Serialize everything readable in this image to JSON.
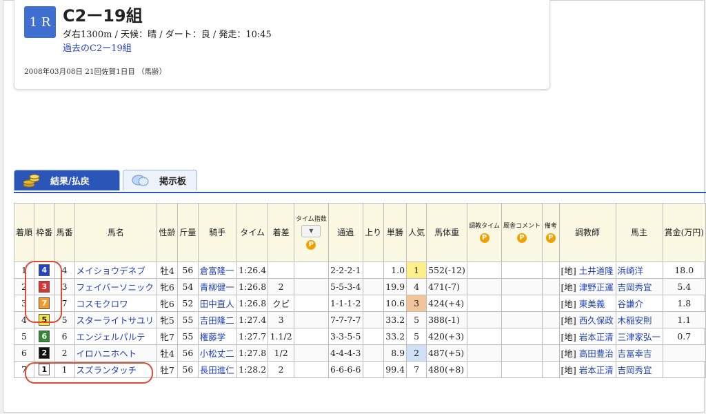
{
  "race": {
    "badge": "1 R",
    "title": "C2ー19組",
    "meta": "ダ右1300m / 天候：晴 / ダート：良 / 発走：10:45",
    "past_link": "過去のC2ー19組",
    "date_line": "2008年03月08日 21回佐賀1日目 （馬齢）"
  },
  "tabs": [
    {
      "label": "結果/払戻"
    },
    {
      "label": "掲示板"
    }
  ],
  "table": {
    "headers": {
      "rank": "着順",
      "frame": "枠番",
      "num": "馬番",
      "horse": "馬名",
      "sexage": "性齢",
      "weight": "斤量",
      "jockey": "騎手",
      "time": "タイム",
      "margin": "着差",
      "timeindex": "タイム指数",
      "passing": "通過",
      "last": "上り",
      "odds": "単勝",
      "pop": "人気",
      "bodyweight": "馬体重",
      "train_time": "調教タイム",
      "stable_comment": "厩舎コメント",
      "notes": "備考",
      "trainer": "調教師",
      "owner": "馬主",
      "prize": "賞金(万円)",
      "p": "P"
    },
    "rows": [
      {
        "rank": "1",
        "frame": "4",
        "num": "4",
        "horse": "メイショウデネブ",
        "sexage": "牡4",
        "weight": "56",
        "jockey": "倉富隆一",
        "time": "1:26.4",
        "margin": "",
        "passing": "2-2-2-1",
        "last": "",
        "odds": "1.0",
        "pop": "1",
        "bodyweight": "552(-12)",
        "trainer": "[地] 土井道隆",
        "owner": "浜崎洋",
        "prize": "18.0"
      },
      {
        "rank": "2",
        "frame": "3",
        "num": "3",
        "horse": "フェイバーソニック",
        "sexage": "牝6",
        "weight": "54",
        "jockey": "青柳健一",
        "time": "1:26.8",
        "margin": "2",
        "passing": "5-5-3-4",
        "last": "",
        "odds": "19.9",
        "pop": "4",
        "bodyweight": "471(-7)",
        "trainer": "[地] 津野正運",
        "owner": "吉岡秀宜",
        "prize": "5.4"
      },
      {
        "rank": "3",
        "frame": "7",
        "num": "7",
        "horse": "コスモクロワ",
        "sexage": "牝6",
        "weight": "52",
        "jockey": "田中直人",
        "time": "1:26.8",
        "margin": "クビ",
        "passing": "1-1-1-2",
        "last": "",
        "odds": "10.6",
        "pop": "3",
        "bodyweight": "424(+4)",
        "trainer": "[地] 東美義",
        "owner": "谷謙介",
        "prize": "1.8"
      },
      {
        "rank": "4",
        "frame": "5",
        "num": "5",
        "horse": "スターライトサユリ",
        "sexage": "牝5",
        "weight": "55",
        "jockey": "吉田隆二",
        "time": "1:27.4",
        "margin": "3",
        "passing": "7-7-7-7",
        "last": "",
        "odds": "33.2",
        "pop": "5",
        "bodyweight": "388(-1)",
        "trainer": "[地] 西久保政",
        "owner": "木稲安則",
        "prize": "1.1"
      },
      {
        "rank": "5",
        "frame": "6",
        "num": "6",
        "horse": "エンジェルパルテ",
        "sexage": "牝7",
        "weight": "55",
        "jockey": "権藤学",
        "time": "1:27.7",
        "margin": "1.1/2",
        "passing": "3-3-5-5",
        "last": "",
        "odds": "33.2",
        "pop": "5",
        "bodyweight": "420(+3)",
        "trainer": "[地] 岩本正清",
        "owner": "三津家弘一",
        "prize": "0.7"
      },
      {
        "rank": "6",
        "frame": "2",
        "num": "2",
        "horse": "イロハニホヘト",
        "sexage": "牡4",
        "weight": "56",
        "jockey": "小松丈二",
        "time": "1:27.8",
        "margin": "1/2",
        "passing": "4-4-4-3",
        "last": "",
        "odds": "8.9",
        "pop": "2",
        "bodyweight": "487(+5)",
        "trainer": "[地] 高田豊治",
        "owner": "吉冨幸吉",
        "prize": ""
      },
      {
        "rank": "7",
        "frame": "1",
        "num": "1",
        "horse": "スズランタッチ",
        "sexage": "牡7",
        "weight": "56",
        "jockey": "長田進仁",
        "time": "1:28.2",
        "margin": "2",
        "passing": "6-6-6-6",
        "last": "",
        "odds": "99.4",
        "pop": "7",
        "bodyweight": "480(+8)",
        "trainer": "[地] 岩本正清",
        "owner": "吉岡秀宜",
        "prize": ""
      }
    ]
  },
  "colors": {
    "frame_1": "#ffffff",
    "frame_2": "#111111",
    "frame_3": "#e53030",
    "frame_4": "#2244cc",
    "frame_5": "#f7e23a",
    "frame_6": "#2d8a2d",
    "frame_7": "#f59a2a",
    "accent": "#2b56b8",
    "highlight_circle": "#d94b34"
  }
}
